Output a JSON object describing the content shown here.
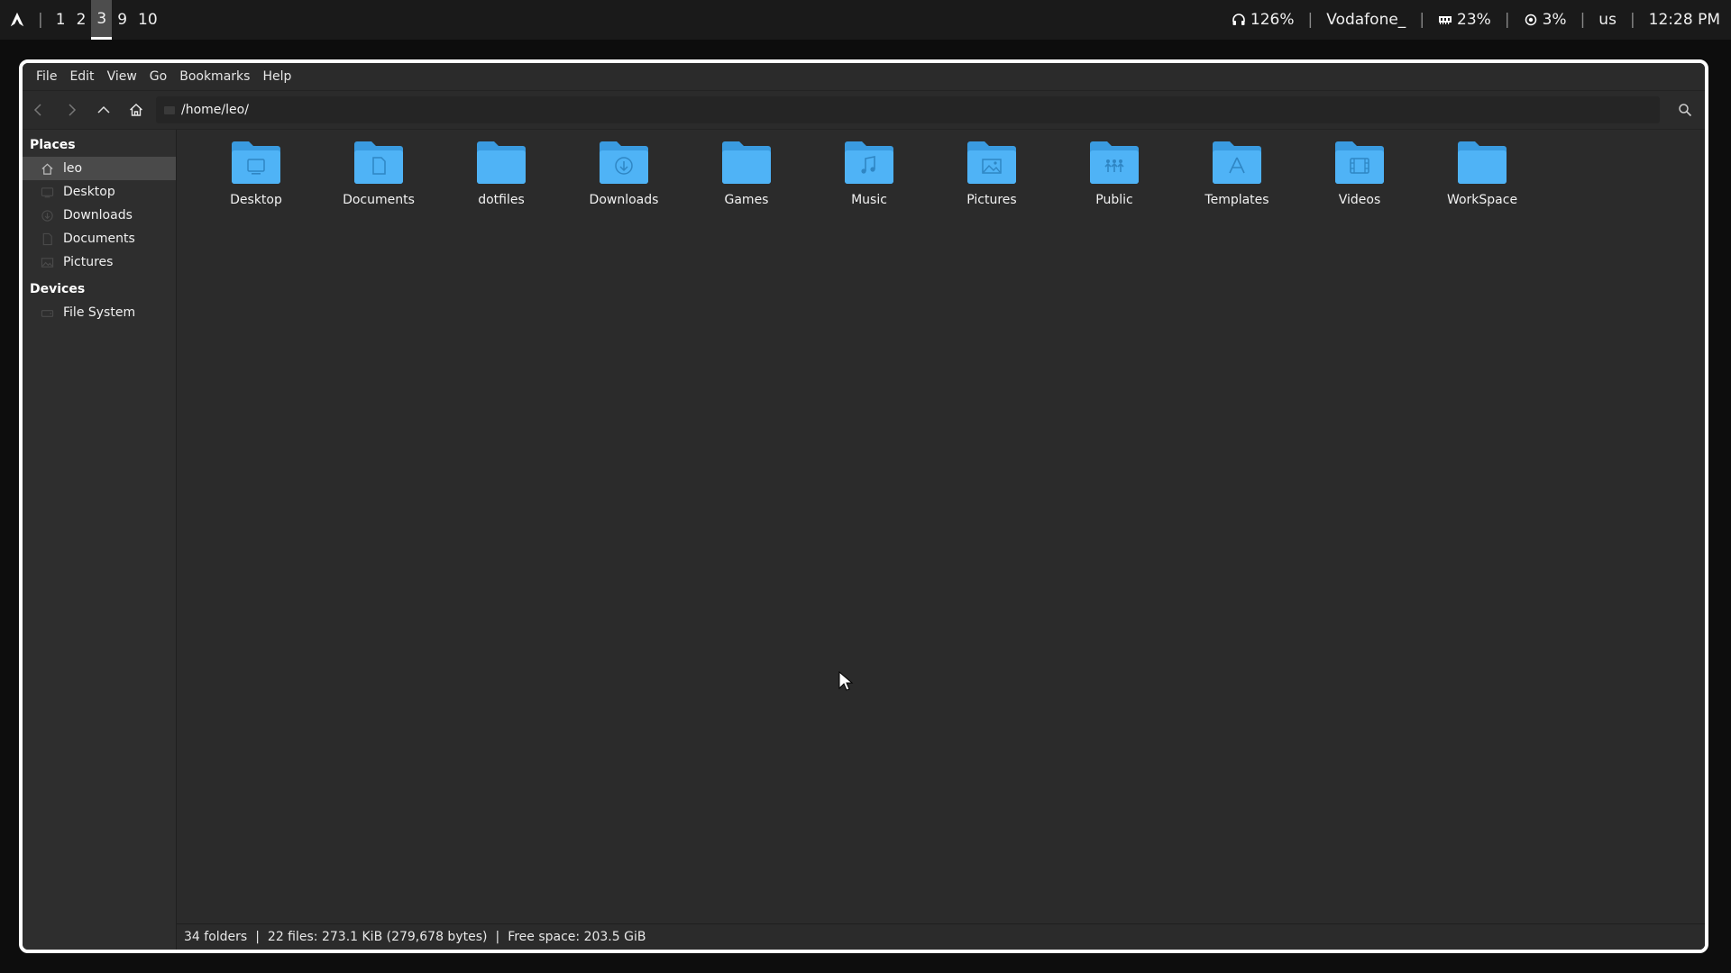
{
  "topbar": {
    "logo_icon": "arch-linux-logo-icon",
    "workspaces": [
      "1",
      "2",
      "3",
      "9",
      "10"
    ],
    "active_workspace": "3",
    "volume": "126%",
    "network": "Vodafone_",
    "memory": "23%",
    "cpu": "3%",
    "keyboard": "us",
    "clock": "12:28 PM"
  },
  "menubar": [
    "File",
    "Edit",
    "View",
    "Go",
    "Bookmarks",
    "Help"
  ],
  "toolbar": {
    "path": "/home/leo/"
  },
  "sidebar": {
    "places_header": "Places",
    "places": [
      {
        "label": "leo",
        "icon": "home-icon"
      },
      {
        "label": "Desktop",
        "icon": "desktop-icon"
      },
      {
        "label": "Downloads",
        "icon": "downloads-icon"
      },
      {
        "label": "Documents",
        "icon": "documents-icon"
      },
      {
        "label": "Pictures",
        "icon": "pictures-icon"
      }
    ],
    "devices_header": "Devices",
    "devices": [
      {
        "label": "File System",
        "icon": "drive-icon"
      }
    ]
  },
  "folders": [
    {
      "label": "Desktop",
      "icon": "folder-desktop-icon"
    },
    {
      "label": "Documents",
      "icon": "folder-documents-icon"
    },
    {
      "label": "dotfiles",
      "icon": "folder-icon"
    },
    {
      "label": "Downloads",
      "icon": "folder-downloads-icon"
    },
    {
      "label": "Games",
      "icon": "folder-icon"
    },
    {
      "label": "Music",
      "icon": "folder-music-icon"
    },
    {
      "label": "Pictures",
      "icon": "folder-pictures-icon"
    },
    {
      "label": "Public",
      "icon": "folder-public-icon"
    },
    {
      "label": "Templates",
      "icon": "folder-templates-icon"
    },
    {
      "label": "Videos",
      "icon": "folder-videos-icon"
    },
    {
      "label": "WorkSpace",
      "icon": "folder-icon"
    }
  ],
  "statusbar": {
    "folders": "34 folders",
    "files": "22 files: 273.1 KiB (279,678 bytes)",
    "free_space": "Free space: 203.5 GiB"
  },
  "colors": {
    "folder": "#4fb3f6",
    "folder_dark": "#3a9be0",
    "accent": "#ffffff"
  }
}
